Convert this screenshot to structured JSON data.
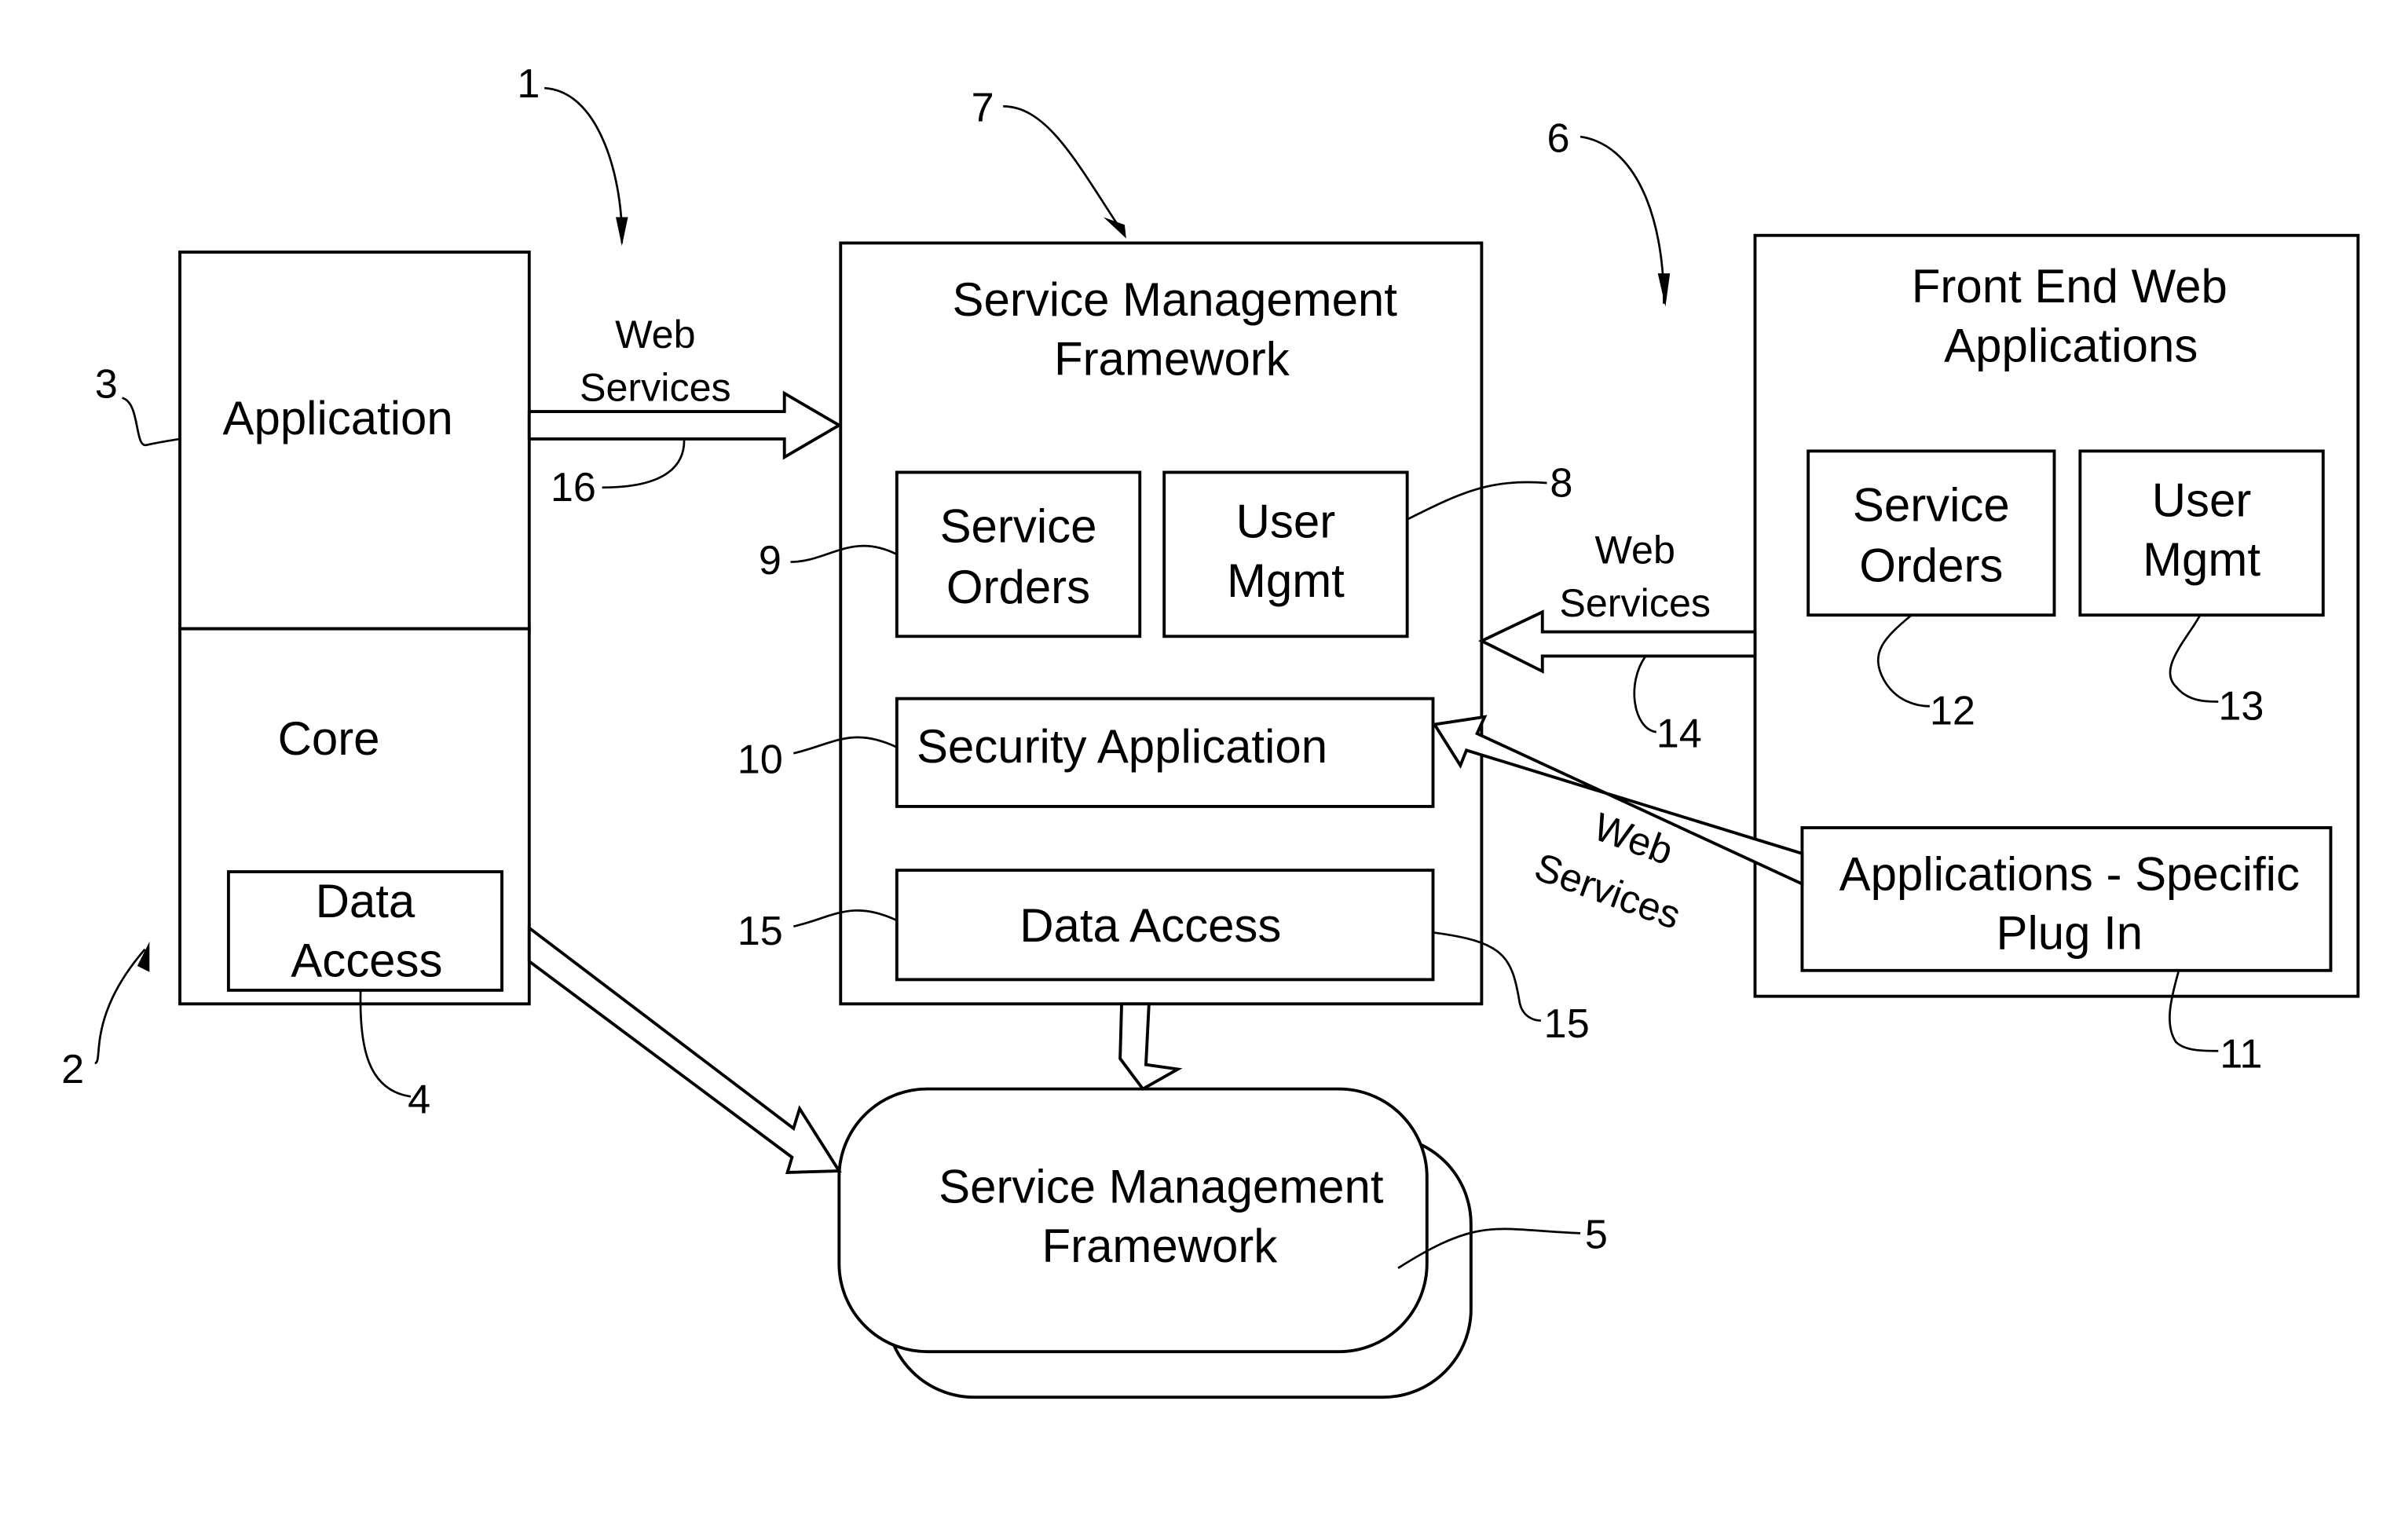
{
  "diagram": {
    "left_system": {
      "application_label": "Application",
      "core_label": "Core",
      "data_access_line1": "Data",
      "data_access_line2": "Access"
    },
    "center_framework": {
      "title_line1": "Service Management",
      "title_line2": "Framework",
      "service_orders_line1": "Service",
      "service_orders_line2": "Orders",
      "user_mgmt_line1": "User",
      "user_mgmt_line2": "Mgmt",
      "security_application": "Security Application",
      "data_access": "Data Access"
    },
    "front_end": {
      "title_line1": "Front End Web",
      "title_line2": "Applications",
      "service_orders_line1": "Service",
      "service_orders_line2": "Orders",
      "user_mgmt_line1": "User",
      "user_mgmt_line2": "Mgmt",
      "plugin_line1": "Applications - Specific",
      "plugin_line2": "Plug In"
    },
    "bottom_framework": {
      "title_line1": "Service Management",
      "title_line2": "Framework"
    },
    "connectors": {
      "web_services_top_line1": "Web",
      "web_services_top_line2": "Services",
      "web_services_right_line1": "Web",
      "web_services_right_line2": "Services",
      "web_services_diag_line1": "Web",
      "web_services_diag_line2": "Services"
    },
    "reference_numerals": {
      "n1": "1",
      "n2": "2",
      "n3": "3",
      "n4": "4",
      "n5": "5",
      "n6": "6",
      "n7": "7",
      "n8": "8",
      "n9": "9",
      "n10": "10",
      "n11": "11",
      "n12": "12",
      "n13": "13",
      "n14": "14",
      "n15a": "15",
      "n15b": "15",
      "n16": "16"
    }
  }
}
